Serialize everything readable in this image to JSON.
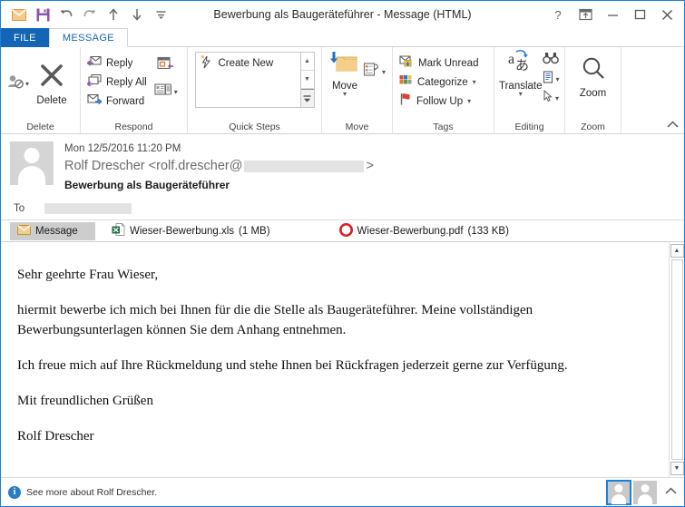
{
  "window": {
    "title": "Bewerbung als Baugeräteführer - Message (HTML)",
    "title_plain": "Bewerbung als Baugeräteführer - Message (HTML)"
  },
  "quick_access": [
    {
      "name": "envelope-icon",
      "label": "Message"
    },
    {
      "name": "save-icon",
      "label": "Save"
    },
    {
      "name": "undo-icon",
      "label": "Undo"
    },
    {
      "name": "redo-icon",
      "label": "Redo"
    },
    {
      "name": "previous-item-icon",
      "label": "Previous Item"
    },
    {
      "name": "next-item-icon",
      "label": "Next Item"
    },
    {
      "name": "customize-qat-icon",
      "label": "Customize Quick Access Toolbar"
    }
  ],
  "window_controls": {
    "help": "?",
    "ribbon_options": "Ribbon Display Options",
    "minimize": "Minimize",
    "maximize": "Maximize",
    "close": "Close"
  },
  "tabs": [
    {
      "label": "FILE",
      "active": false
    },
    {
      "label": "MESSAGE",
      "active": true
    }
  ],
  "ribbon": {
    "groups": [
      {
        "label": "Delete",
        "items": [
          {
            "label": "Delete",
            "icon": "delete-x-icon"
          },
          {
            "label": "Ignore",
            "icon": "ignore-person-icon"
          }
        ]
      },
      {
        "label": "Respond",
        "items": [
          {
            "label": "Reply",
            "icon": "reply-icon"
          },
          {
            "label": "Reply All",
            "icon": "reply-all-icon"
          },
          {
            "label": "Forward",
            "icon": "forward-icon"
          },
          {
            "label": "Meeting",
            "icon": "meeting-icon"
          },
          {
            "label": "More",
            "icon": "more-respond-icon"
          }
        ]
      },
      {
        "label": "Quick Steps",
        "items": [
          {
            "label": "Create New",
            "icon": "quick-step-lightning-icon"
          }
        ]
      },
      {
        "label": "Move",
        "items": [
          {
            "label": "Move",
            "icon": "move-folder-icon"
          },
          {
            "label": "Rules",
            "icon": "rules-icon"
          }
        ]
      },
      {
        "label": "Tags",
        "items": [
          {
            "label": "Mark Unread",
            "icon": "mark-unread-icon"
          },
          {
            "label": "Categorize",
            "icon": "categorize-icon"
          },
          {
            "label": "Follow Up",
            "icon": "follow-up-flag-icon"
          }
        ]
      },
      {
        "label": "Editing",
        "items": [
          {
            "label": "Translate",
            "icon": "translate-icon"
          },
          {
            "label": "Find",
            "icon": "binoculars-icon"
          },
          {
            "label": "Related",
            "icon": "related-document-icon"
          },
          {
            "label": "Select",
            "icon": "select-cursor-icon"
          }
        ]
      },
      {
        "label": "Zoom",
        "items": [
          {
            "label": "Zoom",
            "icon": "zoom-magnifier-icon"
          }
        ]
      }
    ],
    "collapse_label": "Collapse the Ribbon"
  },
  "message": {
    "date": "Mon 12/5/2016 11:20 PM",
    "from_name": "Rolf Drescher",
    "from_prefix": "<rolf.drescher@",
    "from_suffix": ">",
    "from_redacted": true,
    "subject": "Bewerbung als Baugeräteführer",
    "to_label": "To",
    "to_value": "",
    "to_redacted": true
  },
  "attachments": {
    "message_tab": "Message",
    "items": [
      {
        "name": "Wieser-Bewerbung.xls",
        "size": "(1 MB)",
        "icon": "excel-file-icon"
      },
      {
        "name": "Wieser-Bewerbung.pdf",
        "size": "(133 KB)",
        "icon": "pdf-file-icon"
      }
    ]
  },
  "body": {
    "paragraphs": [
      "Sehr geehrte Frau Wieser,",
      "hiermit bewerbe ich mich bei Ihnen für die die Stelle als Baugeräteführer. Meine vollständigen Bewerbungsunterlagen können Sie dem Anhang entnehmen.",
      "Ich freue mich auf Ihre Rückmeldung und stehe Ihnen bei Rückfragen jederzeit gerne zur Verfügung.",
      "Mit freundlichen Grüßen",
      "Rolf Drescher"
    ]
  },
  "statusbar": {
    "info_glyph": "i",
    "text": "See more about Rolf Drescher.",
    "caret": "⌃"
  },
  "colors": {
    "accent_blue": "#1266b5",
    "border_blue": "#1683d8",
    "excel_green": "#1d7044",
    "pdf_red": "#d61f26",
    "folder_tan": "#f5cf87",
    "save_purple": "#8b56a8",
    "envelope_tan": "#eab464"
  }
}
